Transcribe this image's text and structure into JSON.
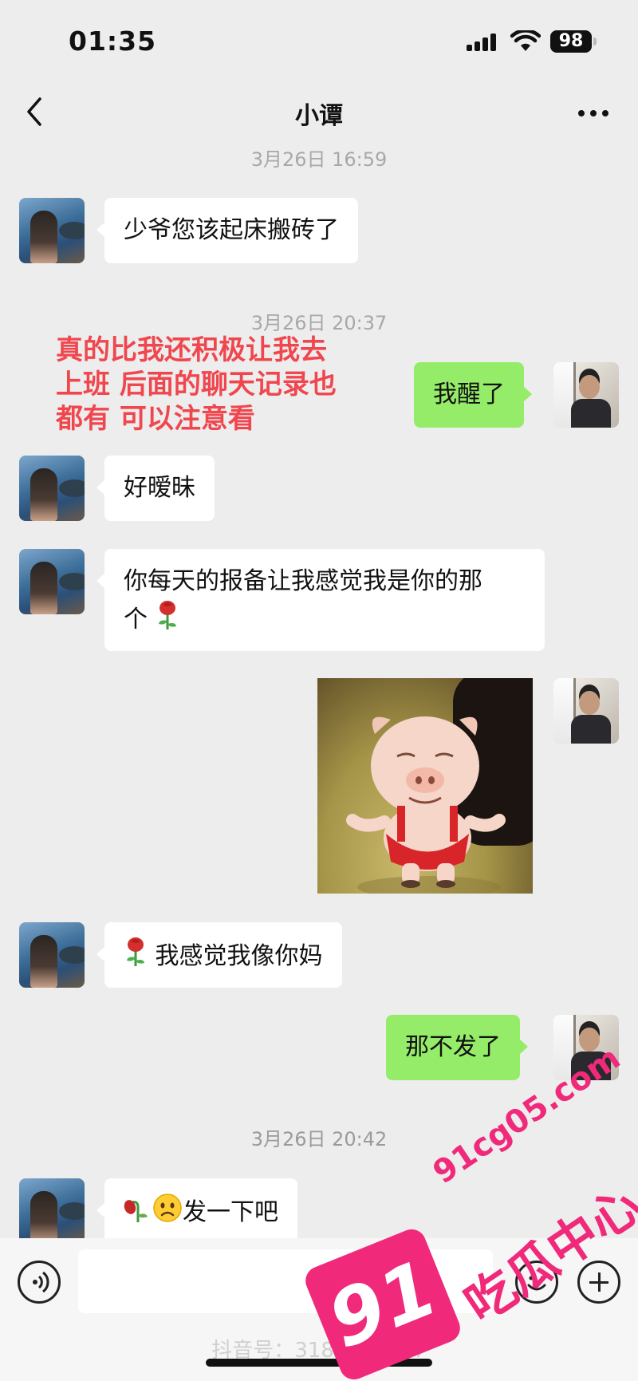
{
  "status_bar": {
    "time": "01:35",
    "battery": "98"
  },
  "header": {
    "title": "小谭"
  },
  "messages": [
    {
      "type": "timestamp",
      "text": "3月26日 16:59"
    },
    {
      "type": "incoming",
      "text": "少爷您该起床搬砖了"
    },
    {
      "type": "timestamp",
      "text": "3月26日 20:37"
    },
    {
      "type": "outgoing",
      "text": "我醒了"
    },
    {
      "type": "incoming",
      "text": "好暧昧"
    },
    {
      "type": "incoming",
      "text_line1": "你每天的报备让我感觉我是你的那",
      "text_line2": "个"
    },
    {
      "type": "outgoing_sticker",
      "sticker": "dancing-pig"
    },
    {
      "type": "incoming",
      "text": "我感觉我像你妈"
    },
    {
      "type": "outgoing",
      "text": "那不发了"
    },
    {
      "type": "timestamp",
      "text": "3月26日 20:42"
    },
    {
      "type": "incoming",
      "text": "发一下吧"
    }
  ],
  "overlay_annotation": {
    "line1": "真的比我还积极让我去",
    "line2": "上班 后面的聊天记录也",
    "line3": "都有 可以注意看",
    "color": "#f0464e"
  },
  "footer": {
    "douyin_id": "抖音号：318..18..787"
  },
  "watermark": {
    "url": "91cg05.com",
    "badge": "91",
    "name": "吃瓜中心",
    "color": "#f0297a"
  },
  "colors": {
    "outgoing_bubble": "#95ec69",
    "incoming_bubble": "#ffffff",
    "background": "#ededed"
  },
  "icons": [
    "back-chevron-icon",
    "more-dots-icon",
    "voice-icon",
    "emoji-icon",
    "plus-icon",
    "rose-emoji",
    "wilted-rose-emoji",
    "frowning-face-emoji"
  ]
}
